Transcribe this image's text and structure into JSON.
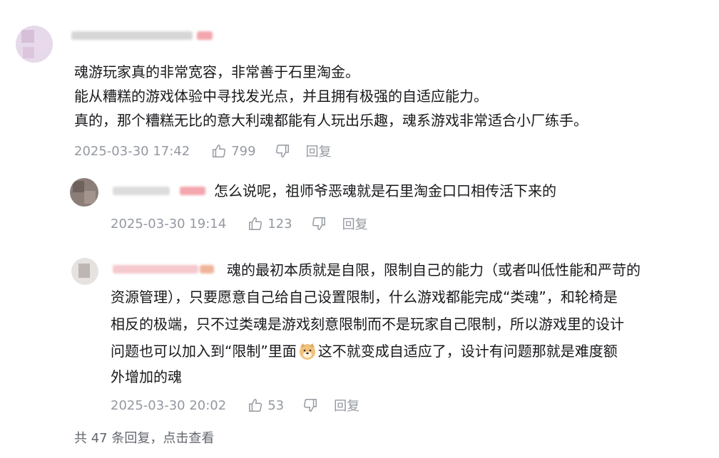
{
  "main_comment": {
    "lines": [
      "魂游玩家真的非常宽容，非常善于石里淘金。",
      "能从糟糕的游戏体验中寻找发光点，并且拥有极强的自适应能力。",
      "真的，那个糟糕无比的意大利魂都能有人玩出乐趣，魂系游戏非常适合小厂练手。"
    ],
    "time": "2025-03-30 17:42",
    "likes": "799",
    "reply_label": "回复"
  },
  "replies": [
    {
      "text": "怎么说呢，祖师爷恶魂就是石里淘金口口相传活下来的",
      "time": "2025-03-30 19:14",
      "likes": "123",
      "reply_label": "回复"
    },
    {
      "lines": [
        "魂的最初本质就是自限，限制自己的能力（或者叫低性能和严苛的",
        "资源管理），只要愿意自己给自己设置限制，什么游戏都能完成“类魂”，和轮椅是",
        "相反的极端，只不过类魂是游戏刻意限制而不是玩家自己限制，所以游戏里的设计",
        "问题也可以加入到“限制”里面",
        "这不就变成自适应了，设计有问题那就是难度额",
        "外增加的魂"
      ],
      "emoji": "doge-emoji",
      "time": "2025-03-30 20:02",
      "likes": "53",
      "reply_label": "回复"
    }
  ],
  "view_more": "共 47 条回复，点击查看",
  "icons": {
    "like": "thumbs-up-icon",
    "dislike": "thumbs-down-icon"
  },
  "colors": {
    "text": "#18191c",
    "meta": "#9499a0",
    "pink_badge": "#f3a6ad"
  }
}
